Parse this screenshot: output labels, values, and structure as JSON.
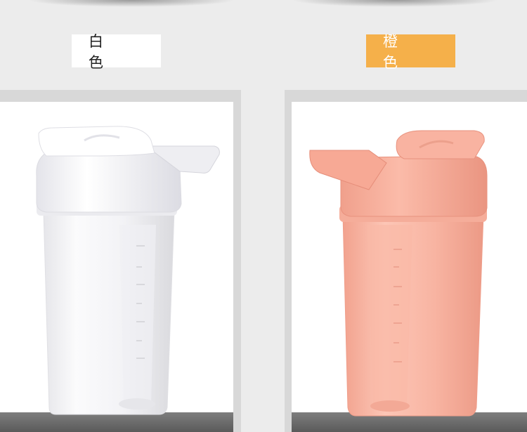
{
  "variants": [
    {
      "label": "白 色",
      "accent_color": "#ffffff",
      "bottle_color": "#f4f4f6"
    },
    {
      "label": "橙 色",
      "accent_color": "#f5b04a",
      "bottle_color": "#f6ae9c"
    }
  ]
}
